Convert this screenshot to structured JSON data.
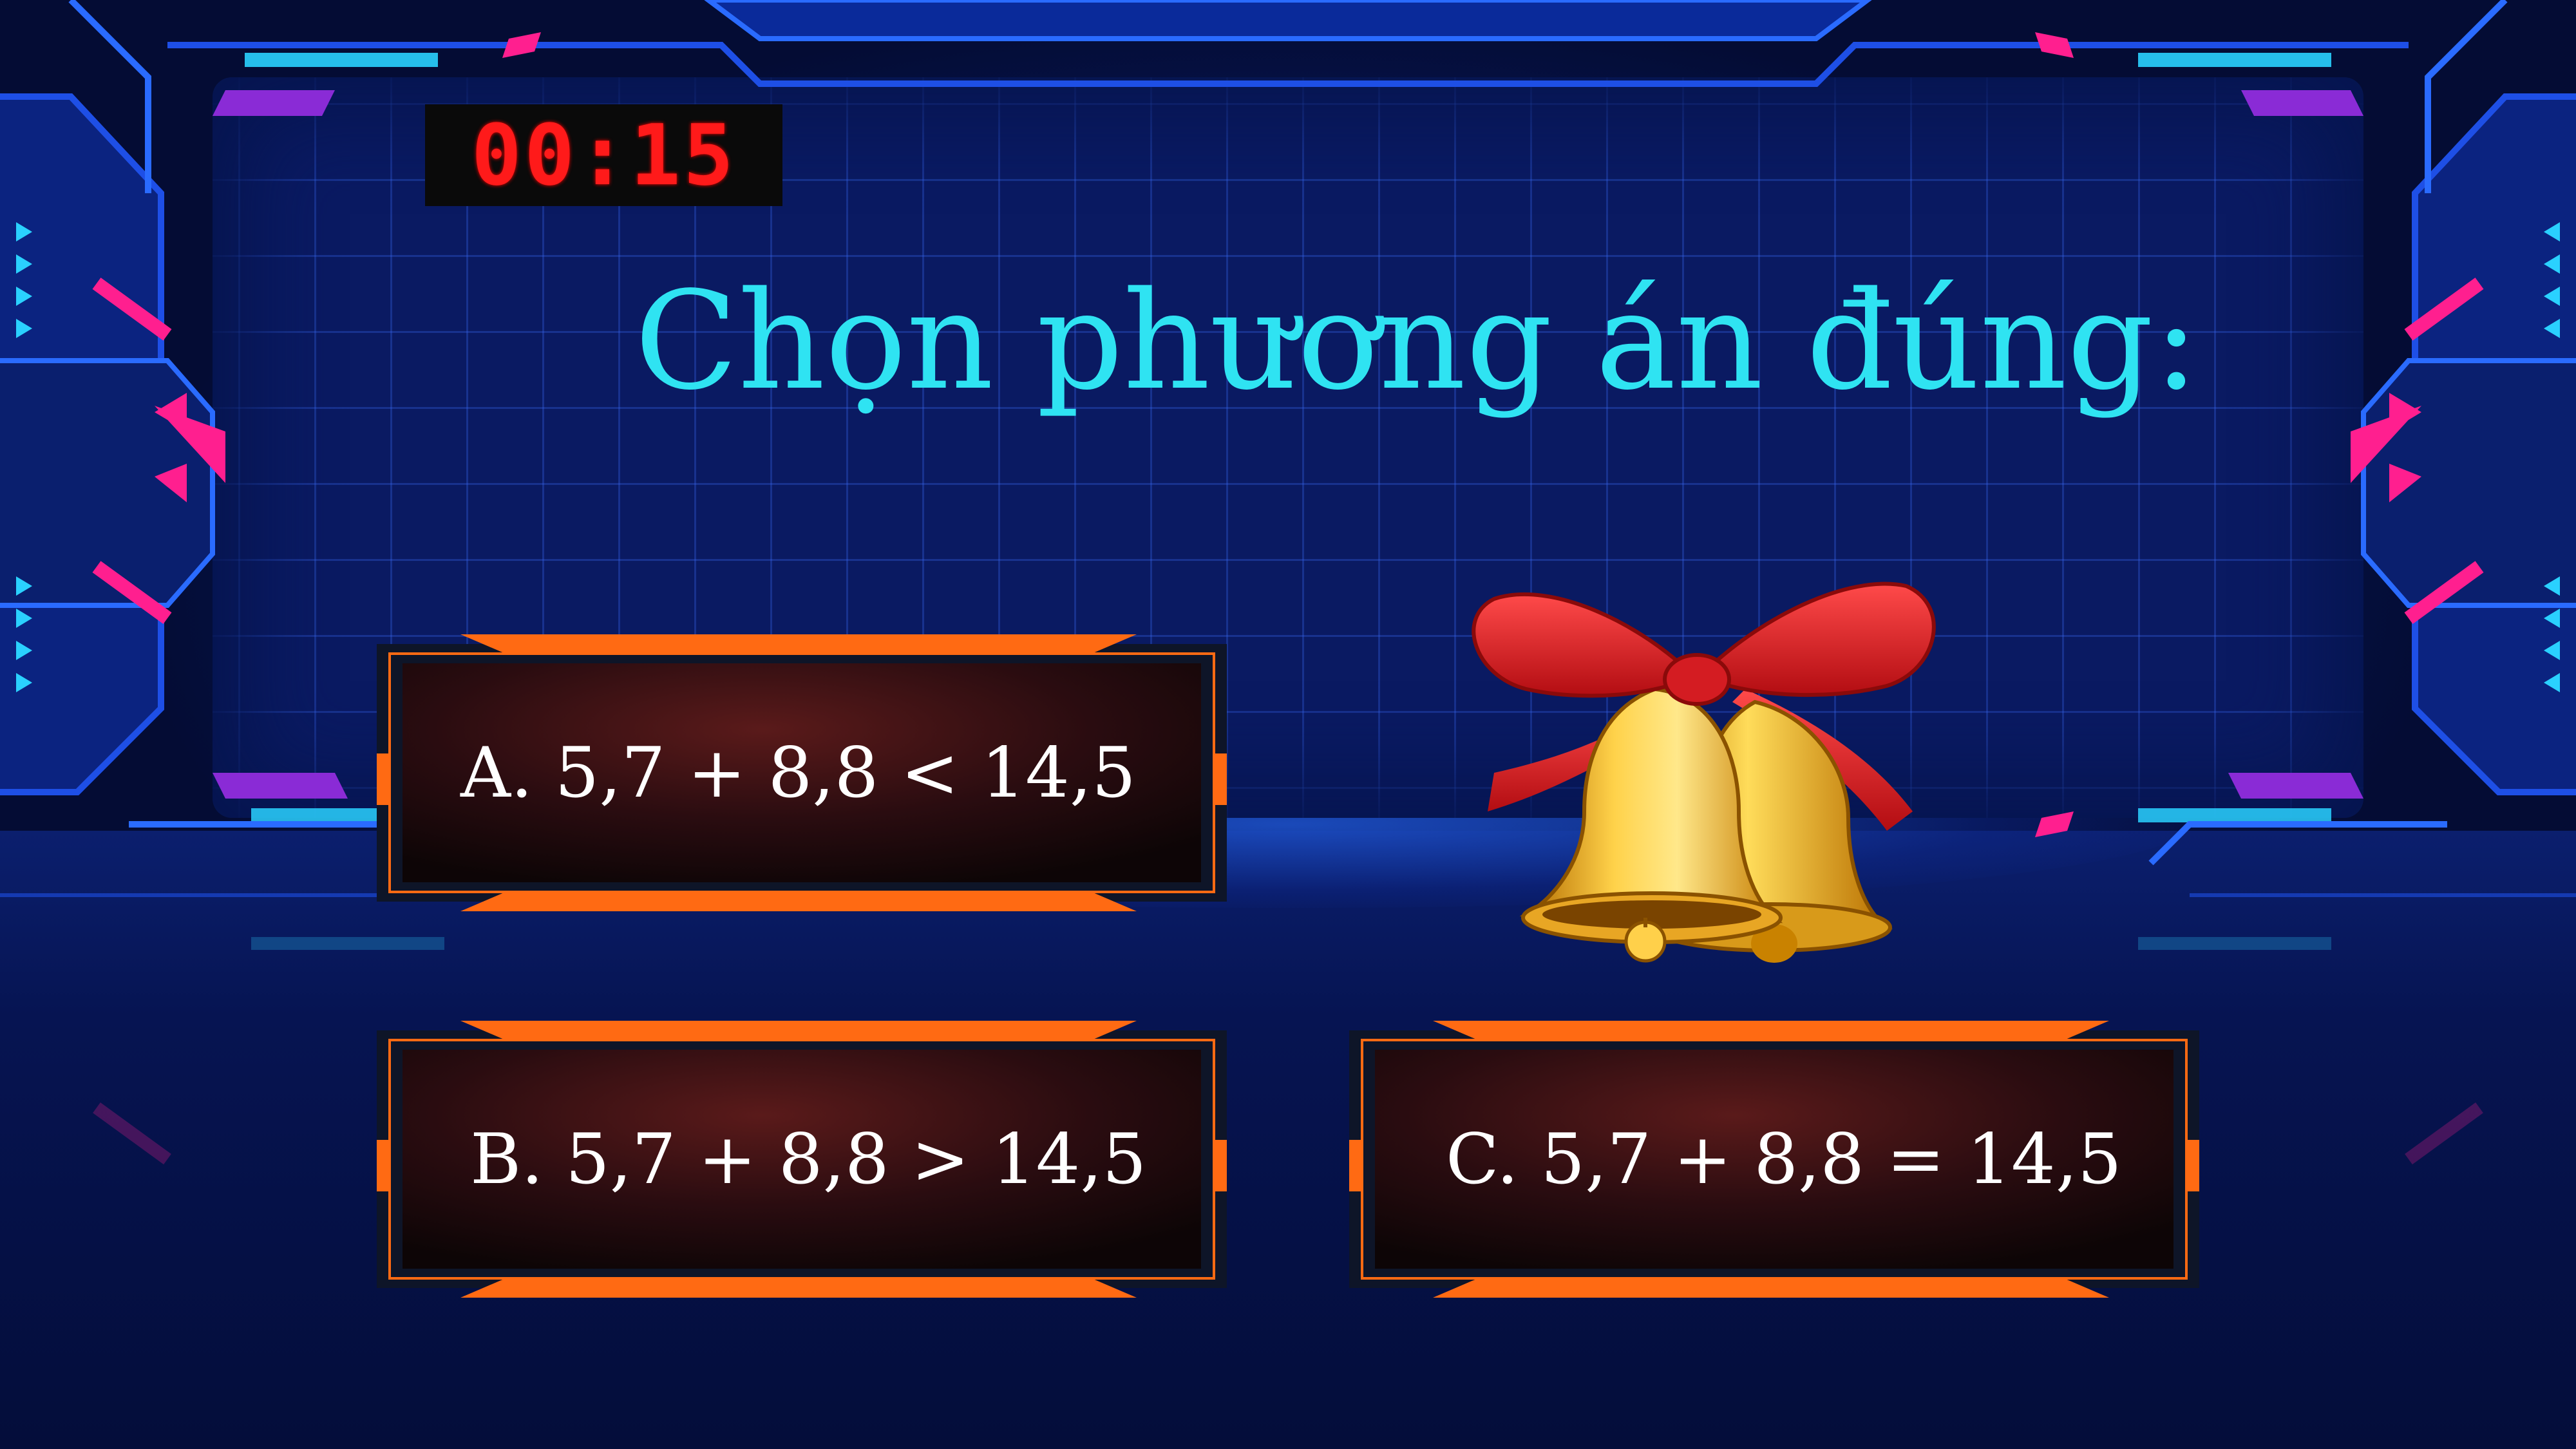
{
  "timer": {
    "value": "00:15"
  },
  "question": {
    "prompt": "Chọn phương án đúng:"
  },
  "answers": [
    {
      "id": "A",
      "label": "A. 5,7 + 8,8 < 14,5"
    },
    {
      "id": "B",
      "label": "B. 5,7 + 8,8 > 14,5"
    },
    {
      "id": "C",
      "label": "C. 5,7 + 8,8 = 14,5"
    }
  ],
  "colors": {
    "background": "#05113f",
    "title": "#2fe3f2",
    "timer": "#ff1a1a",
    "answer_border": "#ff6a13",
    "accent_pink": "#ff1f8f",
    "accent_cyan": "#2ad1ff"
  },
  "icons": [
    "bells-ribbon-icon"
  ]
}
